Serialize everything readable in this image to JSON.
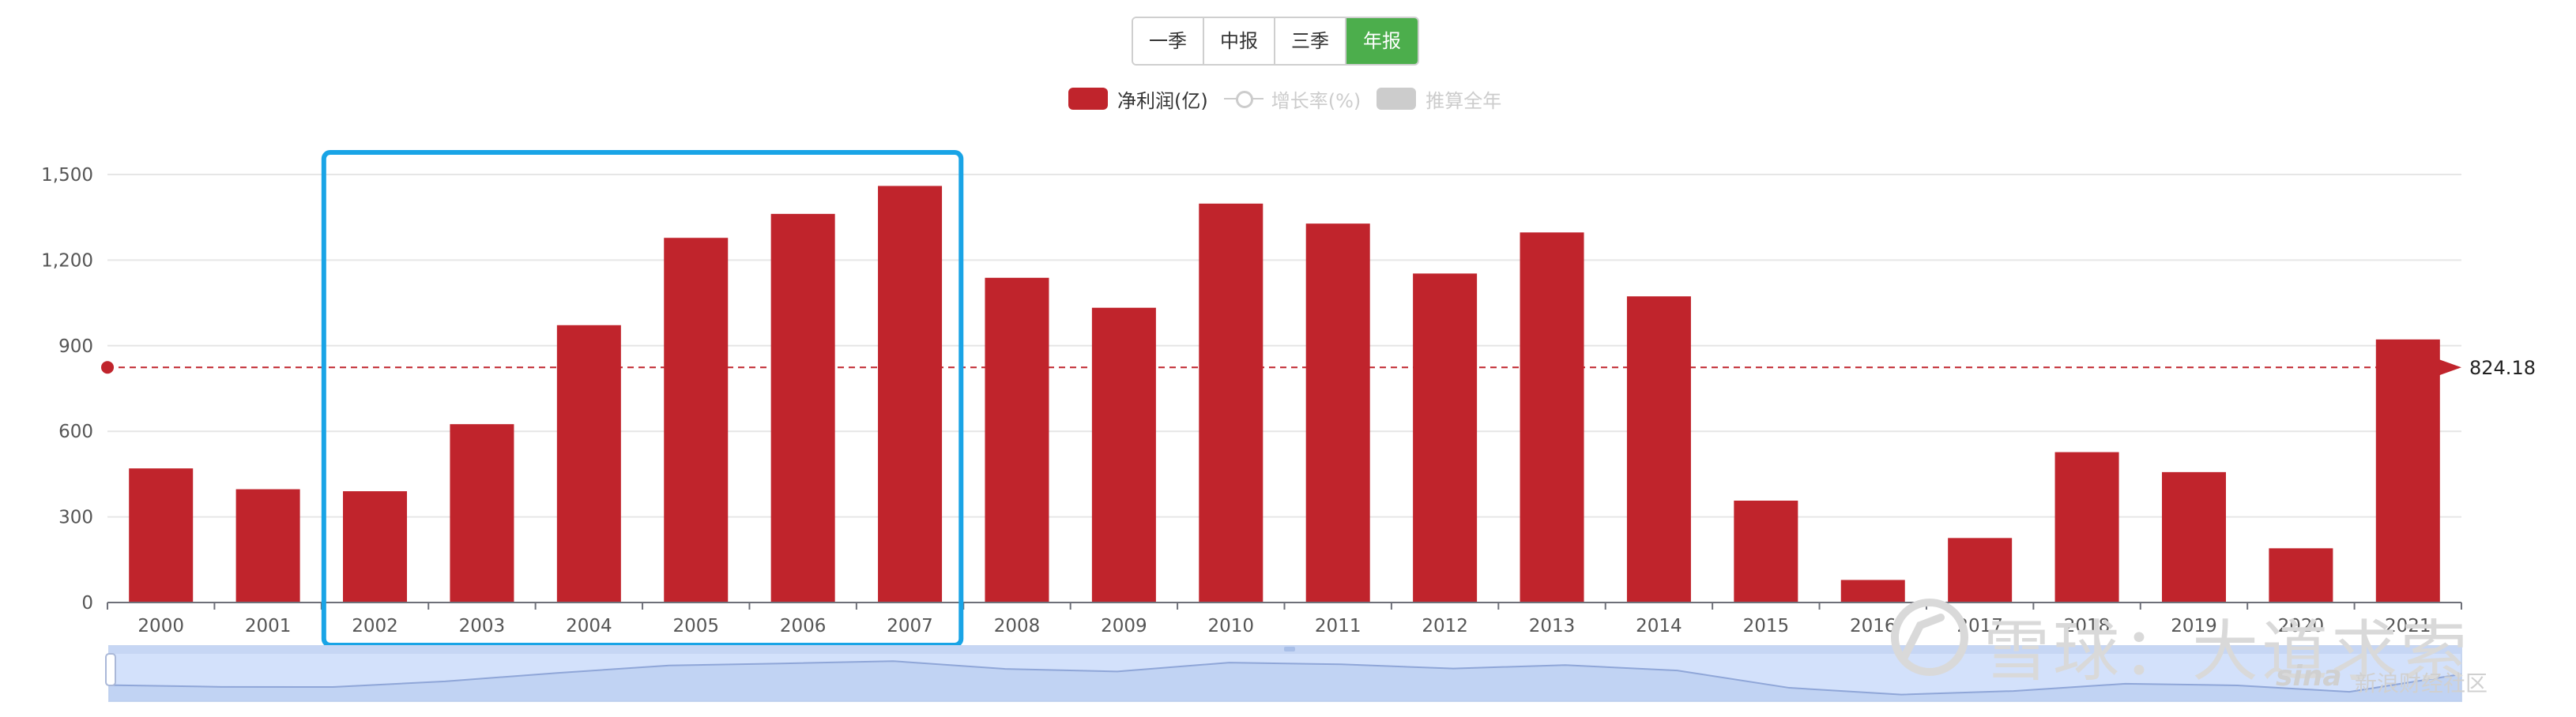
{
  "tabs": [
    {
      "label": "一季",
      "active": false
    },
    {
      "label": "中报",
      "active": false
    },
    {
      "label": "三季",
      "active": false
    },
    {
      "label": "年报",
      "active": true
    }
  ],
  "legend": [
    {
      "name": "净利润(亿)",
      "color": "#c0242c",
      "active": true
    },
    {
      "name": "增长率(%)",
      "color": "#cccccc",
      "active": false
    },
    {
      "name": "推算全年",
      "color": "#cccccc",
      "active": false
    }
  ],
  "chart_data": {
    "type": "bar",
    "categories": [
      "2000",
      "2001",
      "2002",
      "2003",
      "2004",
      "2005",
      "2006",
      "2007",
      "2008",
      "2009",
      "2010",
      "2011",
      "2012",
      "2013",
      "2014",
      "2015",
      "2016",
      "2017",
      "2018",
      "2019",
      "2020",
      "2021"
    ],
    "series": [
      {
        "name": "净利润(亿)",
        "color": "#c0242c",
        "values": [
          470,
          397,
          390,
          625,
          972,
          1278,
          1362,
          1460,
          1138,
          1033,
          1398,
          1328,
          1153,
          1297,
          1073,
          357,
          79,
          226,
          527,
          457,
          190,
          922
        ]
      }
    ],
    "ylim": [
      0,
      1500
    ],
    "yticks": [
      "0",
      "300",
      "600",
      "900",
      "1,200",
      "1,500"
    ],
    "grid": true,
    "average_line": {
      "value": 824.18,
      "label": "824.18",
      "color": "#c0242c"
    },
    "highlight_range": [
      "2002",
      "2007"
    ],
    "highlight_color": "#19a4e6"
  },
  "watermark": {
    "text": "雪球：大道求索",
    "sina_logo": "sina",
    "sina_text": "新浪财经社区"
  }
}
